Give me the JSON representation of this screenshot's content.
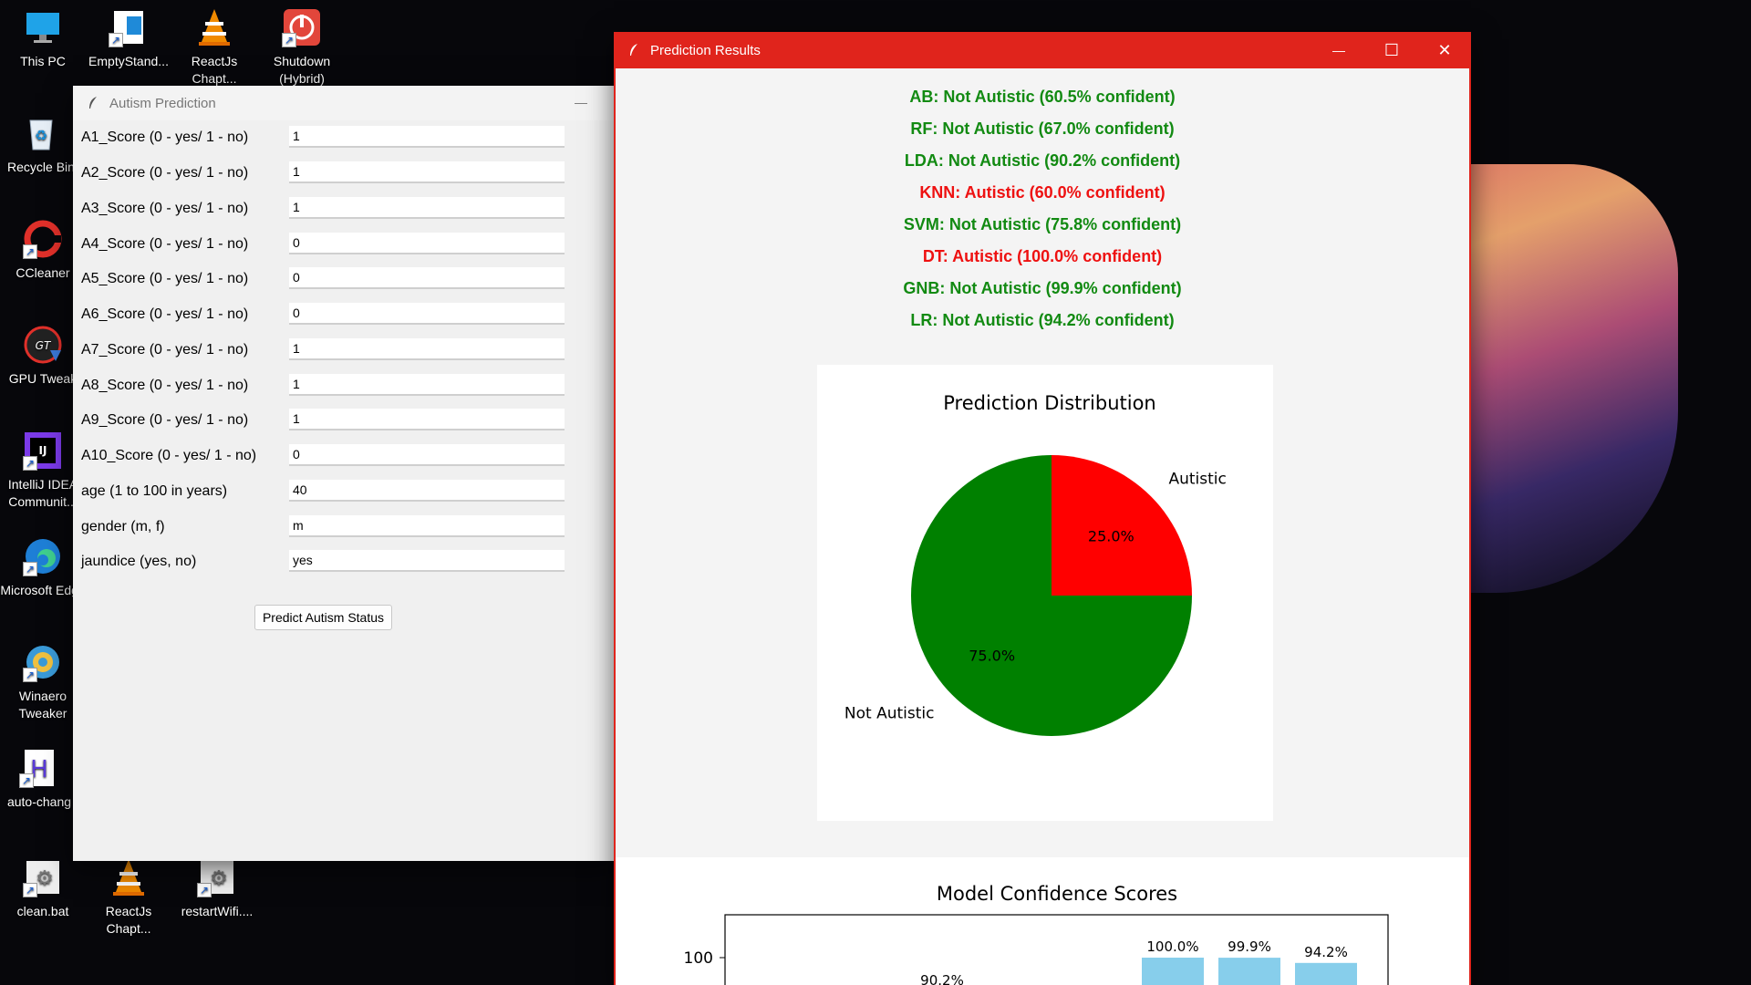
{
  "desktop": {
    "icons": [
      {
        "label": "This PC",
        "icon": "monitor-icon"
      },
      {
        "label": "EmptyStand...",
        "icon": "app-window-icon"
      },
      {
        "label": "ReactJs Chapt...",
        "icon": "vlc-cone-icon"
      },
      {
        "label": "Shutdown (Hybrid)",
        "icon": "power-icon"
      },
      {
        "label": "Recycle Bin",
        "icon": "recycle-bin-icon"
      },
      {
        "label": "CCleaner",
        "icon": "ccleaner-icon"
      },
      {
        "label": "GPU Tweak",
        "icon": "gpu-tweak-icon"
      },
      {
        "label": "IntelliJ IDEA Communit...",
        "icon": "intellij-icon"
      },
      {
        "label": "Microsoft Edge",
        "icon": "edge-icon"
      },
      {
        "label": "Winaero Tweaker",
        "icon": "winaero-icon"
      },
      {
        "label": "auto-chang",
        "icon": "script-icon"
      },
      {
        "label": "clean.bat",
        "icon": "batch-file-icon"
      },
      {
        "label": "ReactJs Chapt...",
        "icon": "vlc-cone-icon"
      },
      {
        "label": "restartWifi....",
        "icon": "batch-file-icon"
      }
    ]
  },
  "autism_window": {
    "title": "Autism Prediction",
    "minimize": "—",
    "fields": [
      {
        "label": "A1_Score (0 - yes/ 1 - no)",
        "value": "1"
      },
      {
        "label": "A2_Score (0 - yes/ 1 - no)",
        "value": "1"
      },
      {
        "label": "A3_Score (0 - yes/ 1 - no)",
        "value": "1"
      },
      {
        "label": "A4_Score (0 - yes/ 1 - no)",
        "value": "0"
      },
      {
        "label": "A5_Score (0 - yes/ 1 - no)",
        "value": "0"
      },
      {
        "label": "A6_Score (0 - yes/ 1 - no)",
        "value": "0"
      },
      {
        "label": "A7_Score (0 - yes/ 1 - no)",
        "value": "1"
      },
      {
        "label": "A8_Score (0 - yes/ 1 - no)",
        "value": "1"
      },
      {
        "label": "A9_Score (0 - yes/ 1 - no)",
        "value": "1"
      },
      {
        "label": "A10_Score (0 - yes/ 1 - no)",
        "value": "0"
      },
      {
        "label": "age (1 to 100 in years)",
        "value": "40"
      },
      {
        "label": "gender (m, f)",
        "value": "m"
      },
      {
        "label": "jaundice (yes, no)",
        "value": "yes"
      }
    ],
    "predict_button": "Predict Autism Status"
  },
  "results_window": {
    "title": "Prediction Results",
    "minimize": "—",
    "maximize": "☐",
    "close": "✕",
    "colors": {
      "not_autistic": "#128a12",
      "autistic": "#ee1111",
      "titlebar": "#e0241c"
    },
    "results": [
      {
        "text": "AB: Not Autistic (60.5% confident)",
        "status": "not_autistic"
      },
      {
        "text": "RF: Not Autistic (67.0% confident)",
        "status": "not_autistic"
      },
      {
        "text": "LDA: Not Autistic (90.2% confident)",
        "status": "not_autistic"
      },
      {
        "text": "KNN: Autistic (60.0% confident)",
        "status": "autistic"
      },
      {
        "text": "SVM: Not Autistic (75.8% confident)",
        "status": "not_autistic"
      },
      {
        "text": "DT: Autistic (100.0% confident)",
        "status": "autistic"
      },
      {
        "text": "GNB: Not Autistic (99.9% confident)",
        "status": "not_autistic"
      },
      {
        "text": "LR: Not Autistic (94.2% confident)",
        "status": "not_autistic"
      }
    ]
  },
  "chart_data": [
    {
      "type": "pie",
      "title": "Prediction Distribution",
      "labels": [
        "Autistic",
        "Not Autistic"
      ],
      "values": [
        25.0,
        75.0
      ],
      "value_labels": [
        "25.0%",
        "75.0%"
      ],
      "colors": [
        "#ff0000",
        "#008000"
      ]
    },
    {
      "type": "bar",
      "title": "Model Confidence Scores",
      "ytick_labels": [
        "100"
      ],
      "ylim": [
        0,
        105
      ],
      "color": "#87ceeb",
      "visible_bars": [
        {
          "value": 100.0,
          "label": "100.0%"
        },
        {
          "value": 99.9,
          "label": "99.9%"
        },
        {
          "value": 94.2,
          "label": "94.2%"
        }
      ],
      "partial_label": "90.2%"
    }
  ]
}
